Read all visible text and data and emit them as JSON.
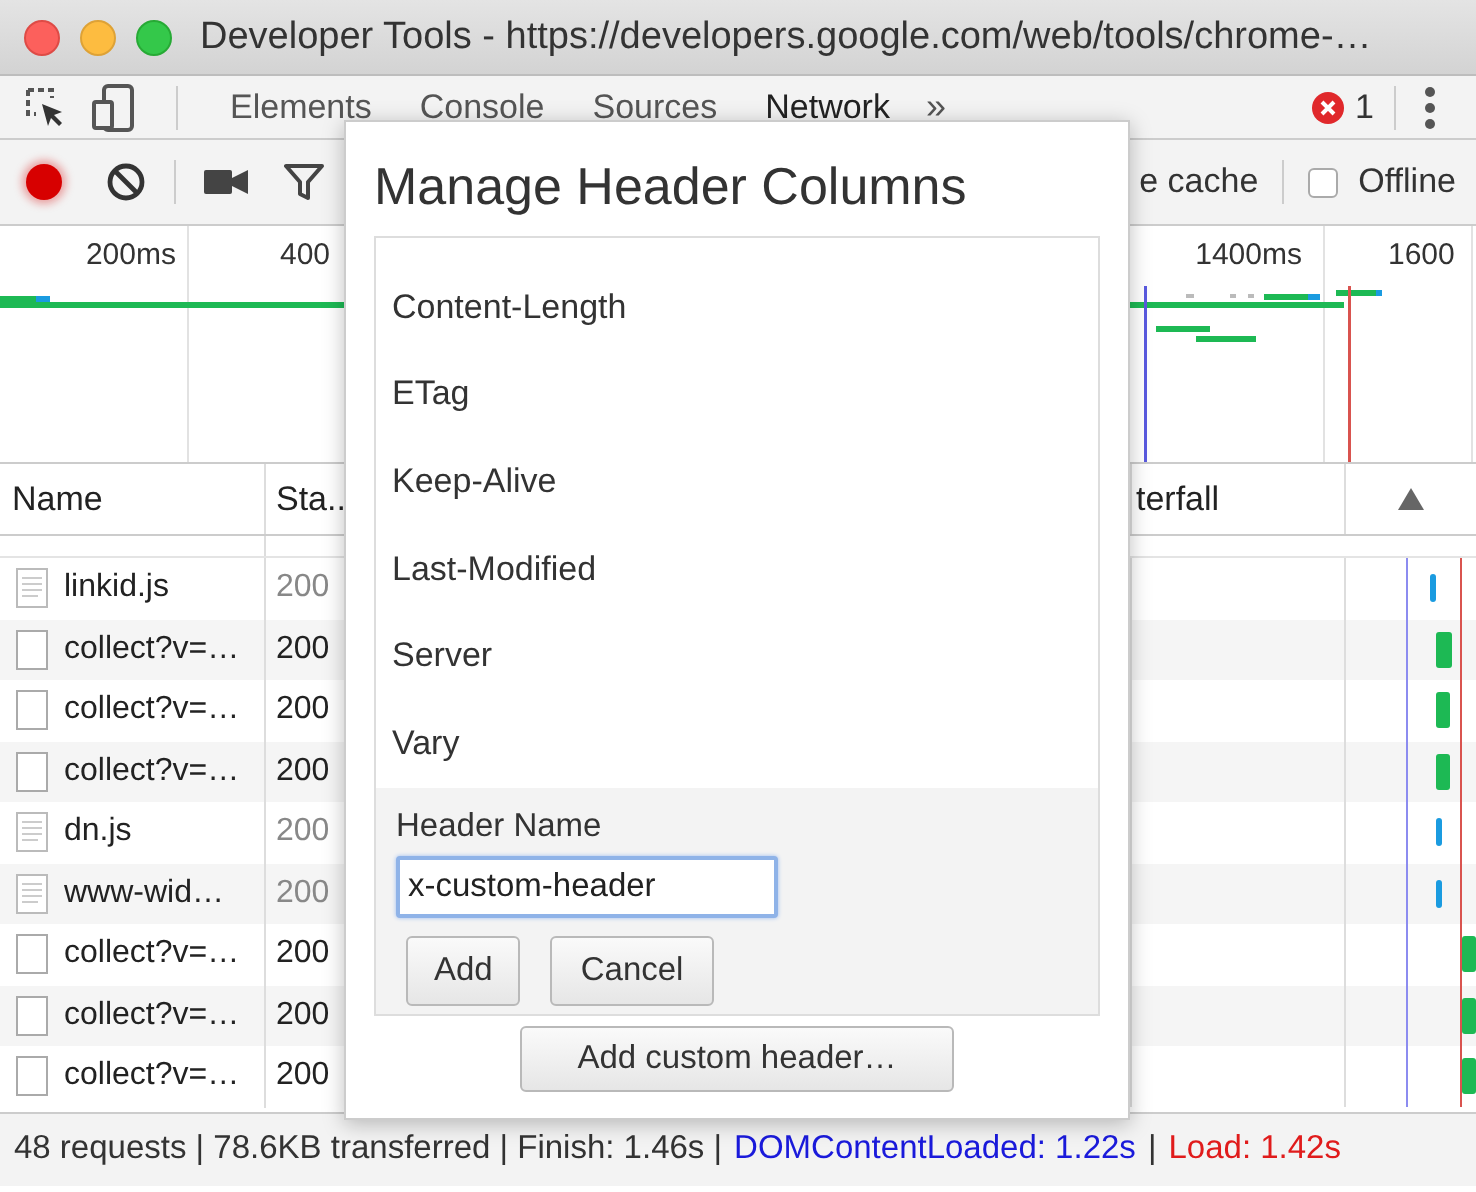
{
  "window": {
    "title": "Developer Tools - https://developers.google.com/web/tools/chrome-…"
  },
  "tabs": [
    {
      "label": "Elements",
      "selected": false
    },
    {
      "label": "Console",
      "selected": false
    },
    {
      "label": "Sources",
      "selected": false
    },
    {
      "label": "Network",
      "selected": true
    }
  ],
  "more_tabs": "»",
  "error_count": "1",
  "toolbar": {
    "recording": true,
    "disable_cache_label": "e cache",
    "offline": {
      "label": "Offline",
      "checked": false
    }
  },
  "overview": {
    "ticks": [
      "200ms",
      "400",
      "1400ms",
      "1600"
    ]
  },
  "table": {
    "columns": [
      "Name",
      "Sta..",
      "terfall"
    ],
    "rows": [
      {
        "name": "linkid.js",
        "status": "200",
        "kind": "script"
      },
      {
        "name": "collect?v=…",
        "status": "200",
        "kind": "xhr"
      },
      {
        "name": "collect?v=…",
        "status": "200",
        "kind": "xhr"
      },
      {
        "name": "collect?v=…",
        "status": "200",
        "kind": "xhr"
      },
      {
        "name": "dn.js",
        "status": "200",
        "kind": "script"
      },
      {
        "name": "www-wid…",
        "status": "200",
        "kind": "script"
      },
      {
        "name": "collect?v=…",
        "status": "200",
        "kind": "xhr"
      },
      {
        "name": "collect?v=…",
        "status": "200",
        "kind": "xhr"
      },
      {
        "name": "collect?v=…",
        "status": "200",
        "kind": "xhr"
      }
    ]
  },
  "dialog": {
    "title": "Manage Header Columns",
    "headers": [
      "Content-Length",
      "ETag",
      "Keep-Alive",
      "Last-Modified",
      "Server",
      "Vary"
    ],
    "form": {
      "label": "Header Name",
      "value": "x-custom-header",
      "focused": true,
      "buttons": [
        "Add",
        "Cancel"
      ]
    },
    "add_button": "Add custom header…"
  },
  "status_bar": {
    "summary": "48 requests | 78.6KB transferred | Finish: 1.46s |",
    "dom_content_loaded": "DOMContentLoaded: 1.22s",
    "separator": "|",
    "load": "Load: 1.42s"
  }
}
